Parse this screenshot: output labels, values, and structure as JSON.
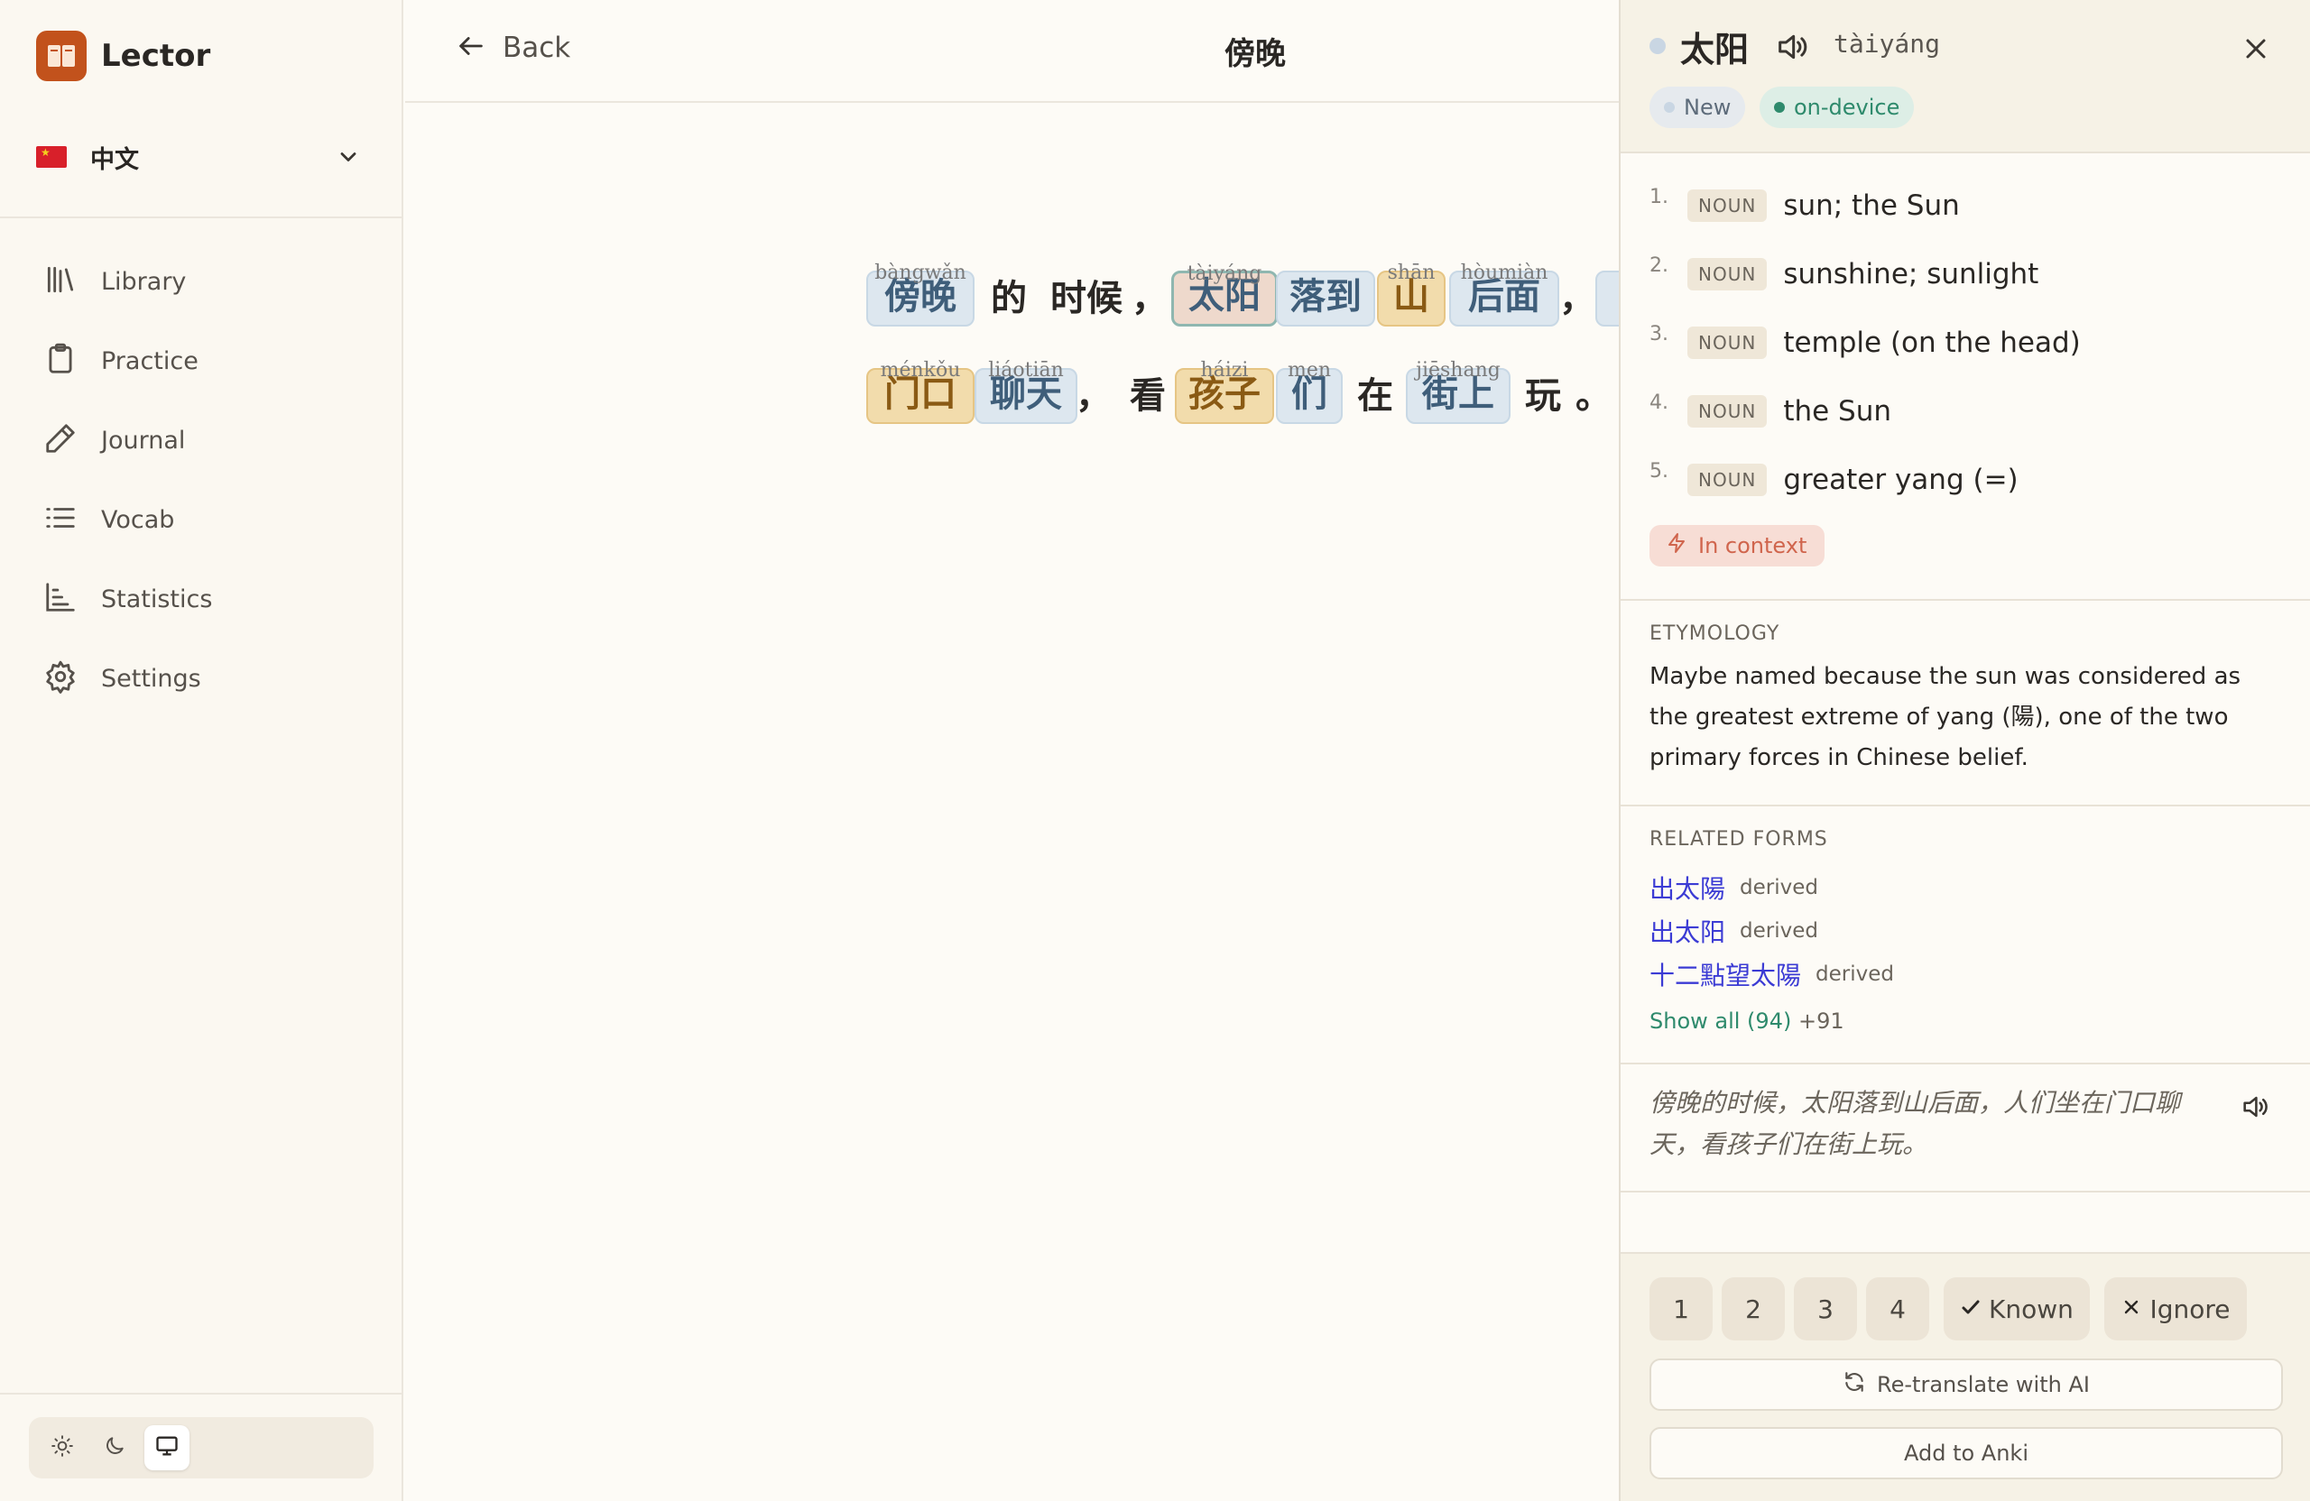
{
  "app": {
    "name": "Lector"
  },
  "language": {
    "label": "中文"
  },
  "nav": {
    "items": [
      {
        "label": "Library",
        "icon": "library-icon"
      },
      {
        "label": "Practice",
        "icon": "clipboard-icon"
      },
      {
        "label": "Journal",
        "icon": "pencil-icon"
      },
      {
        "label": "Vocab",
        "icon": "list-icon"
      },
      {
        "label": "Statistics",
        "icon": "bar-chart-icon"
      },
      {
        "label": "Settings",
        "icon": "gear-icon"
      }
    ]
  },
  "theme": {
    "options": [
      "light",
      "dark",
      "system"
    ],
    "selected": "system"
  },
  "header": {
    "back_label": "Back",
    "title": "傍晚"
  },
  "reader": {
    "line1": [
      {
        "text": "傍晚",
        "pinyin": "bàngwǎn",
        "state": "blue"
      },
      {
        "text": "的",
        "pinyin": "",
        "state": "plain"
      },
      {
        "text": "时候",
        "pinyin": "",
        "state": "plain"
      },
      {
        "text": "，",
        "pinyin": "",
        "state": "plain"
      },
      {
        "text": "太阳",
        "pinyin": "tàiyáng",
        "state": "selected"
      },
      {
        "text": "落到",
        "pinyin": "",
        "state": "blue"
      },
      {
        "text": "山",
        "pinyin": "shān",
        "state": "gold"
      },
      {
        "text": "后面",
        "pinyin": "hòumiàn",
        "state": "blue"
      },
      {
        "text": "，",
        "pinyin": "",
        "state": "plain"
      }
    ],
    "line2": [
      {
        "text": "门口",
        "pinyin": "ménkǒu",
        "state": "gold"
      },
      {
        "text": "聊天",
        "pinyin": "liáotiān",
        "state": "blue"
      },
      {
        "text": "，",
        "pinyin": "",
        "state": "plain"
      },
      {
        "text": "看",
        "pinyin": "",
        "state": "plain"
      },
      {
        "text": "孩子",
        "pinyin": "háizi",
        "state": "gold"
      },
      {
        "text": "们",
        "pinyin": "men",
        "state": "blue"
      },
      {
        "text": "在",
        "pinyin": "",
        "state": "plain"
      },
      {
        "text": "街上",
        "pinyin": "jiēshang",
        "state": "blue"
      },
      {
        "text": "玩",
        "pinyin": "",
        "state": "plain"
      },
      {
        "text": "。",
        "pinyin": "",
        "state": "plain"
      }
    ]
  },
  "panel": {
    "word": "太阳",
    "pinyin": "tàiyáng",
    "tags": {
      "status": "New",
      "source": "on-device"
    },
    "definitions": [
      {
        "num": "1.",
        "pos": "NOUN",
        "text": "sun; the Sun"
      },
      {
        "num": "2.",
        "pos": "NOUN",
        "text": "sunshine; sunlight"
      },
      {
        "num": "3.",
        "pos": "NOUN",
        "text": "temple (on the head)"
      },
      {
        "num": "4.",
        "pos": "NOUN",
        "text": "the Sun"
      },
      {
        "num": "5.",
        "pos": "NOUN",
        "text": "greater yang (=)"
      }
    ],
    "context_label": "In context",
    "etymology_heading": "ETYMOLOGY",
    "etymology_text": "Maybe named because the sun was considered as the greatest extreme of yang (陽), one of the two primary forces in Chinese belief.",
    "related_heading": "RELATED FORMS",
    "related": [
      {
        "word": "出太陽",
        "kind": "derived"
      },
      {
        "word": "出太阳",
        "kind": "derived"
      },
      {
        "word": "十二點望太陽",
        "kind": "derived"
      }
    ],
    "show_all": "Show all (94)",
    "show_more": "+91",
    "sentence": "傍晚的时候，太阳落到山后面，人们坐在门口聊天，看孩子们在街上玩。",
    "ratings": [
      "1",
      "2",
      "3",
      "4"
    ],
    "known_label": "Known",
    "ignore_label": "Ignore",
    "retranslate_label": "Re-translate with AI",
    "anki_label": "Add to Anki"
  }
}
